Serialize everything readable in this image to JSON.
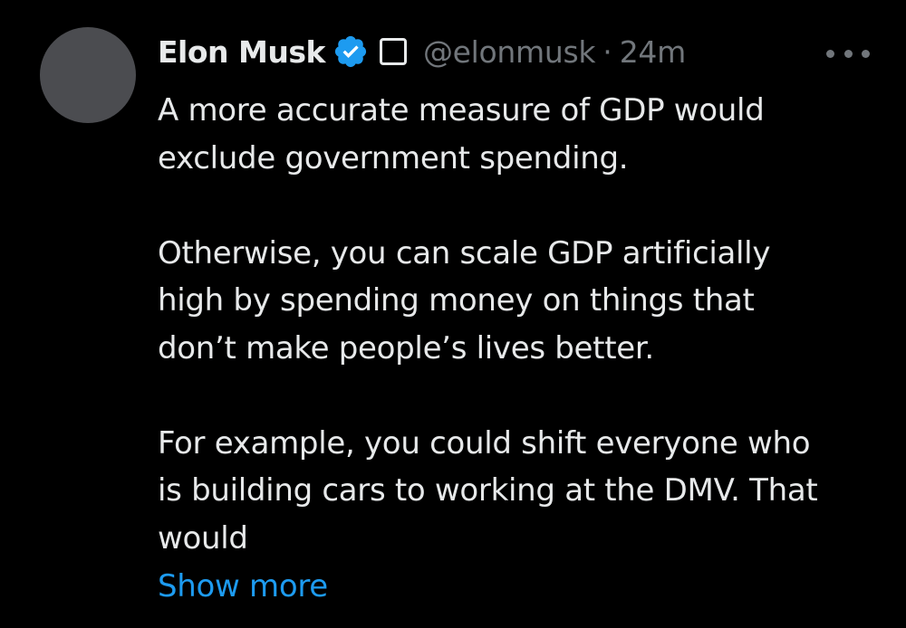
{
  "colors": {
    "background": "#000000",
    "text_primary": "#e7e9ea",
    "text_secondary": "#71767b",
    "accent_link": "#1d9bf0",
    "verified_badge": "#1d9bf0",
    "avatar_placeholder": "#4b4c50"
  },
  "author": {
    "name": "Elon Musk",
    "handle": "@elonmusk",
    "separator": "·",
    "time": "24m",
    "verified_icon": "verified-badge-icon",
    "affiliate_icon": "affiliate-square-icon"
  },
  "more_menu": {
    "icon": "more-horizontal-icon"
  },
  "tweet": {
    "paragraphs": [
      "A more accurate measure of GDP would\nexclude government spending.",
      "Otherwise, you can scale GDP artificially\nhigh by spending money on things that\ndon’t make people’s lives better.",
      "For example, you could shift everyone who\nis building cars to working at the DMV. That\nwould"
    ],
    "show_more_label": "Show more"
  }
}
